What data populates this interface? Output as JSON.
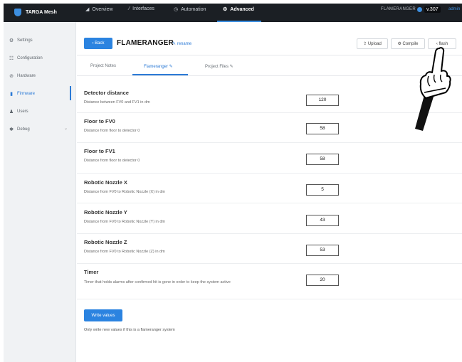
{
  "topbar": {
    "brand": "TARGA Mesh",
    "nav": [
      {
        "label": "Overview",
        "icon": "chart-icon",
        "glyph": "◢"
      },
      {
        "label": "Interfaces",
        "icon": "link-icon",
        "glyph": "⁄"
      },
      {
        "label": "Automation",
        "icon": "clock-icon",
        "glyph": "◷"
      },
      {
        "label": "Advanced",
        "icon": "gear-icon",
        "glyph": "⚙"
      }
    ],
    "device": "FLAMERANGER",
    "version": "v.307",
    "user": "admin"
  },
  "sidebar": {
    "items": [
      {
        "label": "Settings",
        "icon": "gear-icon",
        "glyph": "⚙"
      },
      {
        "label": "Configuration",
        "icon": "sliders-icon",
        "glyph": "☷"
      },
      {
        "label": "Hardware",
        "icon": "chip-icon",
        "glyph": "⊘"
      },
      {
        "label": "Firmware",
        "icon": "file-icon",
        "glyph": "▮"
      },
      {
        "label": "Users",
        "icon": "user-icon",
        "glyph": "♟"
      },
      {
        "label": "Debug",
        "icon": "bug-icon",
        "glyph": "✱"
      }
    ],
    "active": "Firmware"
  },
  "header": {
    "back": "‹ Back",
    "title": "FLAMERANGER",
    "rename": "✎ rename",
    "toolbar": {
      "upload": "⇪ Upload",
      "compile": "⚙ Compile",
      "flash": "‹ flash"
    }
  },
  "tabs": [
    {
      "label": "Project Notes"
    },
    {
      "label": "Flameranger ✎"
    },
    {
      "label": "Project Files ✎"
    }
  ],
  "fields": [
    {
      "label": "Detector distance",
      "desc": "Distance between FV0 and FV1 in dm",
      "value": "120"
    },
    {
      "label": "Floor to FV0",
      "desc": "Distance from floor to detector 0",
      "value": "58"
    },
    {
      "label": "Floor to FV1",
      "desc": "Distance from floor to detector 0",
      "value": "58"
    },
    {
      "label": "Robotic Nozzle X",
      "desc": "Distance from FV0 to Robotic Nozzle (X) in dm",
      "value": "5"
    },
    {
      "label": "Robotic Nozzle Y",
      "desc": "Distance from FV0 to Robotic Nozzle (Y) in dm",
      "value": "43"
    },
    {
      "label": "Robotic Nozzle Z",
      "desc": "Distance from FV0 to Robotic Nozzle (Z) in dm",
      "value": "53"
    },
    {
      "label": "Timer",
      "desc": "Timer that holds alarms after confirmed hit is gone in order to keep the system active",
      "value": "20"
    }
  ],
  "write": {
    "button": "Write values",
    "note": "Only write new values if this is a flameranger system"
  },
  "colors": {
    "accent": "#2b83e0",
    "topbar": "#1b1f24",
    "sidebar": "#f0f2f4"
  }
}
